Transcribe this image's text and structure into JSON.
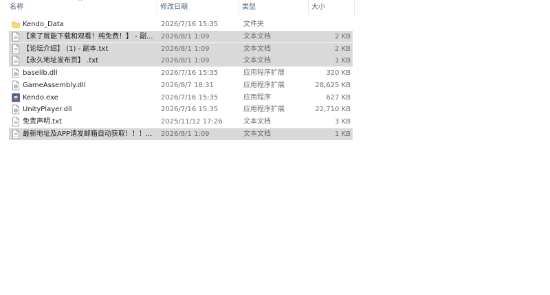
{
  "columns": {
    "name": "名称",
    "date": "修改日期",
    "type": "类型",
    "size": "大小",
    "sort_indicator": "^"
  },
  "files": [
    {
      "name": "Kendo_Data",
      "date": "2026/7/16 15:35",
      "type": "文件夹",
      "size": "",
      "icon": "folder-icon",
      "selected": false
    },
    {
      "name": "【来了就能下载和观看！纯免费！】 - 副...",
      "date": "2026/8/1 1:09",
      "type": "文本文档",
      "size": "2 KB",
      "icon": "text-file-icon",
      "selected": true
    },
    {
      "name": "【论坛介绍】 (1) - 副本.txt",
      "date": "2026/8/1 1:09",
      "type": "文本文档",
      "size": "2 KB",
      "icon": "text-file-icon",
      "selected": true
    },
    {
      "name": "【永久地址发布页】 .txt",
      "date": "2026/8/1 1:09",
      "type": "文本文档",
      "size": "1 KB",
      "icon": "text-file-icon",
      "selected": true
    },
    {
      "name": "baselib.dll",
      "date": "2026/7/16 15:35",
      "type": "应用程序扩展",
      "size": "320 KB",
      "icon": "dll-file-icon",
      "selected": false
    },
    {
      "name": "GameAssembly.dll",
      "date": "2026/8/7 18:31",
      "type": "应用程序扩展",
      "size": "28,625 KB",
      "icon": "dll-file-icon",
      "selected": false
    },
    {
      "name": "Kendo.exe",
      "date": "2026/7/16 15:35",
      "type": "应用程序",
      "size": "627 KB",
      "icon": "exe-app-icon",
      "selected": false
    },
    {
      "name": "UnityPlayer.dll",
      "date": "2026/7/16 15:35",
      "type": "应用程序扩展",
      "size": "22,710 KB",
      "icon": "dll-file-icon",
      "selected": false
    },
    {
      "name": "免责声明.txt",
      "date": "2025/11/12 17:26",
      "type": "文本文档",
      "size": "3 KB",
      "icon": "text-file-icon",
      "selected": false
    },
    {
      "name": "最新地址及APP请发邮箱自动获取！！！...",
      "date": "2026/8/1 1:09",
      "type": "文本文档",
      "size": "1 KB",
      "icon": "text-file-icon",
      "selected": true
    }
  ],
  "colors": {
    "header_text": "#4c607a",
    "selection": "#d9d9d9",
    "folder": "#f3c94b"
  }
}
